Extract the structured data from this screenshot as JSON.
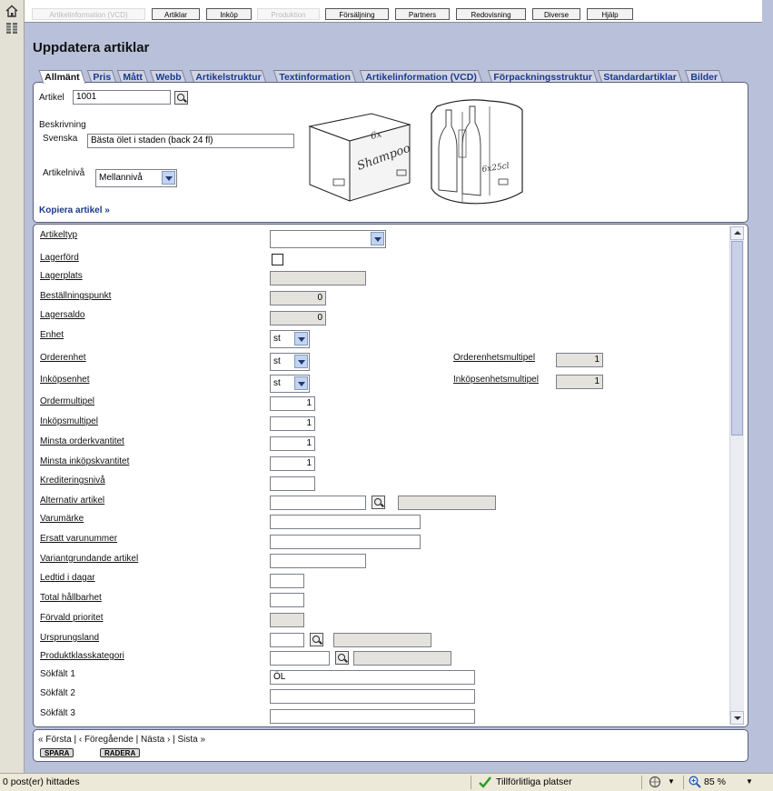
{
  "nav": {
    "items": [
      {
        "label": "Artikelinformation (VCD)",
        "disabled": true
      },
      {
        "label": "Artiklar",
        "disabled": false
      },
      {
        "label": "Inköp",
        "disabled": false
      },
      {
        "label": "Produktion",
        "disabled": true
      },
      {
        "label": "Försäljning",
        "disabled": false
      },
      {
        "label": "Partners",
        "disabled": false
      },
      {
        "label": "Redovisning",
        "disabled": false
      },
      {
        "label": "Diverse",
        "disabled": false
      },
      {
        "label": "Hjälp",
        "disabled": false
      }
    ]
  },
  "page": {
    "title": "Uppdatera artiklar"
  },
  "tabs": [
    {
      "label": "Allmänt",
      "active": true
    },
    {
      "label": "Pris"
    },
    {
      "label": "Mått"
    },
    {
      "label": "Webb"
    },
    {
      "label": "Artikelstruktur"
    },
    {
      "label": "Textinformation"
    },
    {
      "label": "Artikelinformation (VCD)"
    },
    {
      "label": "Förpackningsstruktur"
    },
    {
      "label": "Standardartiklar"
    },
    {
      "label": "Bilder"
    }
  ],
  "header_form": {
    "article_label": "Artikel",
    "article_value": "1001",
    "description_heading": "Beskrivning",
    "language_label": "Svenska",
    "description_value": "Bästa ölet i staden (back 24 fl)",
    "level_label": "Artikelnivå",
    "level_value": "Mellannivå",
    "copy_link": "Kopiera artikel »",
    "image1_text": [
      "6x",
      "Shampoo"
    ],
    "image2_text": "6x25cl"
  },
  "fields": {
    "artikeltyp": {
      "label": "Artikeltyp",
      "value": ""
    },
    "lagerford": {
      "label": "Lagerförd",
      "checked": false
    },
    "lagerplats": {
      "label": "Lagerplats",
      "value": ""
    },
    "bestallningspunkt": {
      "label": "Beställningspunkt",
      "value": "0"
    },
    "lagersaldo": {
      "label": "Lagersaldo",
      "value": "0"
    },
    "enhet": {
      "label": "Enhet",
      "value": "st"
    },
    "orderenhet": {
      "label": "Orderenhet",
      "value": "st"
    },
    "orderenhetsmultipel": {
      "label": "Orderenhetsmultipel",
      "value": "1"
    },
    "inkopsenhet": {
      "label": "Inköpsenhet",
      "value": "st"
    },
    "inkopsenhetsmultipel": {
      "label": "Inköpsenhetsmultipel",
      "value": "1"
    },
    "ordermultipel": {
      "label": "Ordermultipel",
      "value": "1"
    },
    "inkopsmultipel": {
      "label": "Inköpsmultipel",
      "value": "1"
    },
    "minsta_orderkvantitet": {
      "label": "Minsta orderkvantitet",
      "value": "1"
    },
    "minsta_inkopskvantitet": {
      "label": "Minsta inköpskvantitet",
      "value": "1"
    },
    "krediteringsniva": {
      "label": "Krediteringsnivå",
      "value": ""
    },
    "alternativ_artikel": {
      "label": "Alternativ artikel",
      "value": ""
    },
    "varumarke": {
      "label": "Varumärke",
      "value": ""
    },
    "ersatt_varunummer": {
      "label": "Ersatt varunummer",
      "value": ""
    },
    "variantgrundande": {
      "label": "Variantgrundande artikel",
      "value": ""
    },
    "ledtid": {
      "label": "Ledtid i dagar",
      "value": ""
    },
    "total_hallbarhet": {
      "label": "Total hållbarhet",
      "value": ""
    },
    "forvald_prioritet": {
      "label": "Förvald prioritet",
      "value": ""
    },
    "ursprungsland": {
      "label": "Ursprungsland",
      "value": ""
    },
    "produktklasskategori": {
      "label": "Produktklasskategori",
      "value": ""
    },
    "sokfalt1": {
      "label": "Sökfält 1",
      "value": "ÖL"
    },
    "sokfalt2": {
      "label": "Sökfält 2",
      "value": ""
    },
    "sokfalt3": {
      "label": "Sökfält 3",
      "value": ""
    }
  },
  "pager": {
    "first": "« Första",
    "prev": "‹ Föregående",
    "next": "Nästa ›",
    "last": "Sista »",
    "save": "SPARA",
    "delete": "RADERA"
  },
  "statusbar": {
    "left": "0 post(er) hittades",
    "zone": "Tillförlitliga platser",
    "zoom": "85 %"
  },
  "colors": {
    "link": "#1a3a8c",
    "page_bg": "#b9c0d9",
    "tab_bg": "#cfd3e3"
  }
}
